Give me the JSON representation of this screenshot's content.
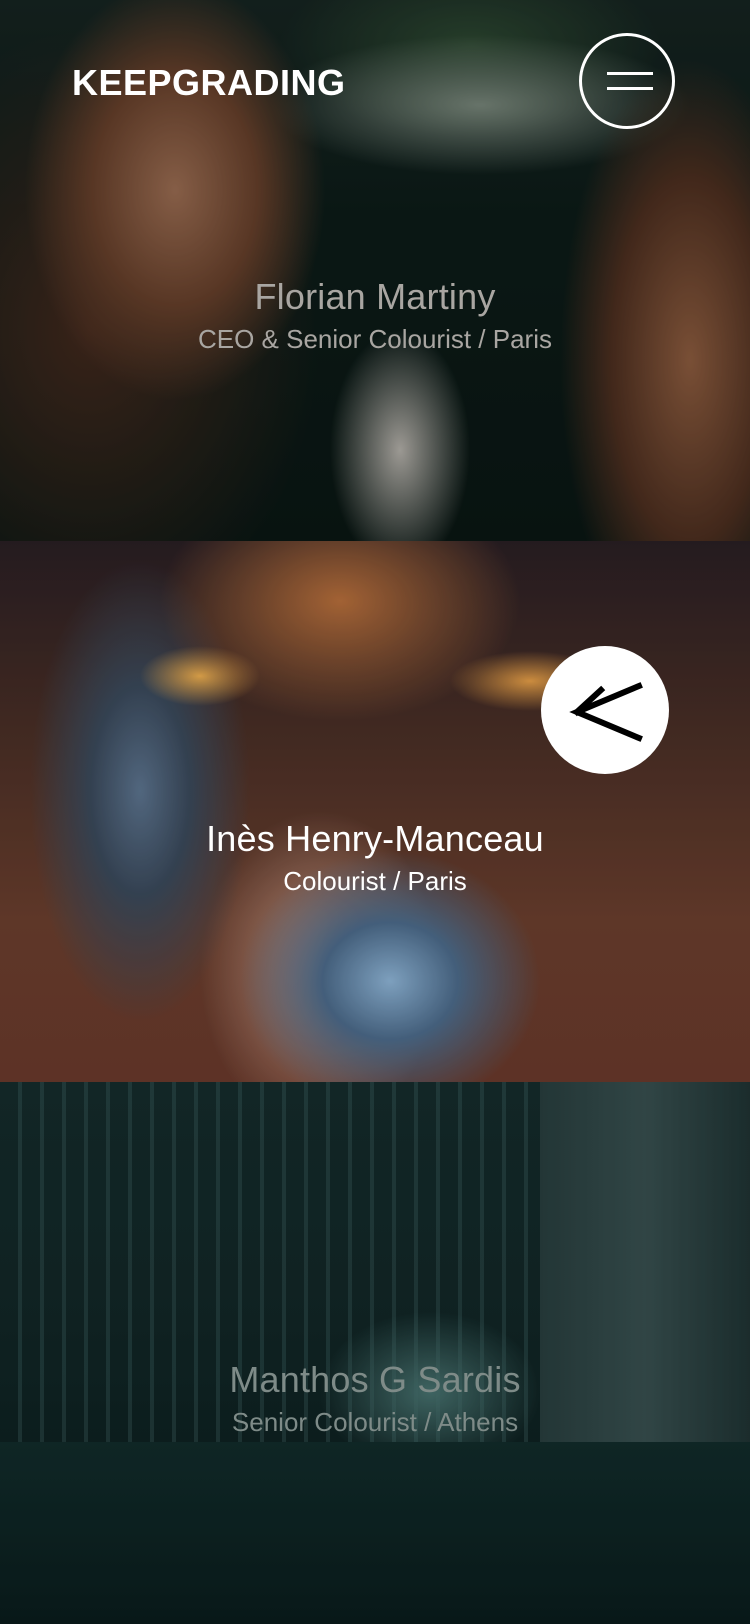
{
  "header": {
    "logo_text": "KEEPGRADING",
    "menu_icon": "hamburger-menu-icon"
  },
  "team": [
    {
      "name": "Florian Martiny",
      "role": "CEO & Senior Colourist / Paris"
    },
    {
      "name": "Inès Henry-Manceau",
      "role": "Colourist / Paris"
    },
    {
      "name": "Manthos G Sardis",
      "role": "Senior Colourist / Athens"
    }
  ],
  "active_card": {
    "arrow_icon": "arrow-down-left-icon"
  },
  "colors": {
    "active_text": "#ffffff",
    "inactive_text": "#a9a6a2",
    "accent_button": "#ffffff"
  }
}
